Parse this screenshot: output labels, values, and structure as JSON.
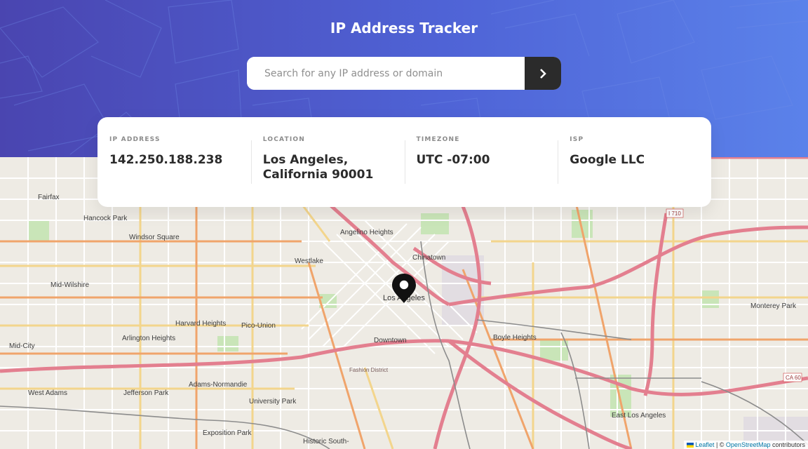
{
  "header": {
    "title": "IP Address Tracker",
    "search_placeholder": "Search for any IP address or domain",
    "search_value": ""
  },
  "info": {
    "ip": {
      "label": "IP ADDRESS",
      "value": "142.250.188.238"
    },
    "location": {
      "label": "LOCATION",
      "value_line1": "Los Angeles,",
      "value_line2": "California 90001"
    },
    "timezone": {
      "label": "TIMEZONE",
      "value": "UTC -07:00"
    },
    "isp": {
      "label": "ISP",
      "value": "Google LLC"
    }
  },
  "map": {
    "places": {
      "fairfax": "Fairfax",
      "hancock_park": "Hancock Park",
      "windsor_square": "Windsor Square",
      "angelino_heights": "Angelino Heights",
      "chinatown": "Chinatown",
      "westlake": "Westlake",
      "mid_wilshire": "Mid-Wilshire",
      "los_angeles": "Los Angeles",
      "monterey_park": "Monterey Park",
      "harvard_heights": "Harvard Heights",
      "pico_union": "Pico-Union",
      "arlington_heights": "Arlington Heights",
      "downtown": "Downtown",
      "boyle_heights": "Boyle Heights",
      "mid_city": "Mid-City",
      "fashion_district": "Fashion District",
      "west_adams": "West Adams",
      "jefferson_park": "Jefferson Park",
      "adams_normandie": "Adams-Normandie",
      "university_park": "University Park",
      "exposition_park": "Exposition Park",
      "historic_south": "Historic South-",
      "east_los_angeles": "East Los Angeles"
    },
    "routes": {
      "i710": "I 710",
      "ca60": "CA 60"
    },
    "attribution": {
      "leaflet": "Leaflet",
      "separator": " | © ",
      "osm": "OpenStreetMap",
      "contributors": " contributors"
    }
  },
  "colors": {
    "header_start": "#4a45b0",
    "header_end": "#5b82ea",
    "button_bg": "#2b2b2b",
    "value_text": "#2b2b2b",
    "label_text": "#8b8b8b"
  },
  "icons": {
    "search_button": "chevron-right-icon",
    "marker": "location-marker-icon"
  }
}
